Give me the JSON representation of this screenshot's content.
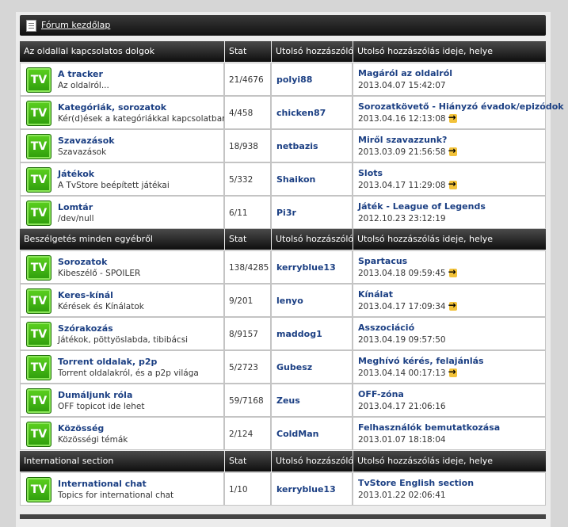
{
  "breadcrumb": {
    "label": "Fórum kezdőlap"
  },
  "columns": {
    "stat": "Stat",
    "last_poster": "Utolsó hozzászóló",
    "last_post": "Utolsó hozzászólás ideje, helye"
  },
  "icon_text": "TV",
  "sections": [
    {
      "title": "Az oldallal kapcsolatos dolgok",
      "forums": [
        {
          "title": "A tracker",
          "desc": "Az oldalról...",
          "stat": "21/4676",
          "user": "polyi88",
          "post": "Magáról az oldalról",
          "date": "2013.04.07 15:42:07",
          "go": false
        },
        {
          "title": "Kategóriák, sorozatok",
          "desc": "Kér(d)ések a kategóriákkal kapcsolatban",
          "stat": "4/458",
          "user": "chicken87",
          "post": "Sorozatkövető - Hiányzó évadok/epizódok",
          "date": "2013.04.16 12:13:08",
          "go": true
        },
        {
          "title": "Szavazások",
          "desc": "Szavazások",
          "stat": "18/938",
          "user": "netbazis",
          "post": "Miről szavazzunk?",
          "date": "2013.03.09 21:56:58",
          "go": true
        },
        {
          "title": "Játékok",
          "desc": "A TvStore beépített játékai",
          "stat": "5/332",
          "user": "Shaikon",
          "post": "Slots",
          "date": "2013.04.17 11:29:08",
          "go": true
        },
        {
          "title": "Lomtár",
          "desc": "/dev/null",
          "stat": "6/11",
          "user": "Pi3r",
          "post": "Játék - League of Legends",
          "date": "2012.10.23 23:12:19",
          "go": false
        }
      ]
    },
    {
      "title": "Beszélgetés minden egyébről",
      "forums": [
        {
          "title": "Sorozatok",
          "desc": "Kibeszélő - SPOILER",
          "stat": "138/4285",
          "user": "kerryblue13",
          "post": "Spartacus",
          "date": "2013.04.18 09:59:45",
          "go": true
        },
        {
          "title": "Keres-kínál",
          "desc": "Kérések és Kínálatok",
          "stat": "9/201",
          "user": "lenyo",
          "post": "Kínálat",
          "date": "2013.04.17 17:09:34",
          "go": true
        },
        {
          "title": "Szórakozás",
          "desc": "Játékok, pöttyöslabda, tibibácsi",
          "stat": "8/9157",
          "user": "maddog1",
          "post": "Asszociáció",
          "date": "2013.04.19 09:57:50",
          "go": false
        },
        {
          "title": "Torrent oldalak, p2p",
          "desc": "Torrent oldalakról, és a p2p világa",
          "stat": "5/2723",
          "user": "Gubesz",
          "post": "Meghívó kérés, felajánlás",
          "date": "2013.04.14 00:17:13",
          "go": true
        },
        {
          "title": "Dumáljunk róla",
          "desc": "OFF topicot ide lehet",
          "stat": "59/7168",
          "user": "Zeus",
          "post": "OFF-zóna",
          "date": "2013.04.17 21:06:16",
          "go": false
        },
        {
          "title": "Közösség",
          "desc": "Közösségi témák",
          "stat": "2/124",
          "user": "ColdMan",
          "post": "Felhasználók bemutatkozása",
          "date": "2013.01.07 18:18:04",
          "go": false
        }
      ]
    },
    {
      "title": "International section",
      "forums": [
        {
          "title": "International chat",
          "desc": "Topics for international chat",
          "stat": "1/10",
          "user": "kerryblue13",
          "post": "TvStore English section",
          "date": "2013.01.22 02:06:41",
          "go": false
        }
      ]
    }
  ]
}
